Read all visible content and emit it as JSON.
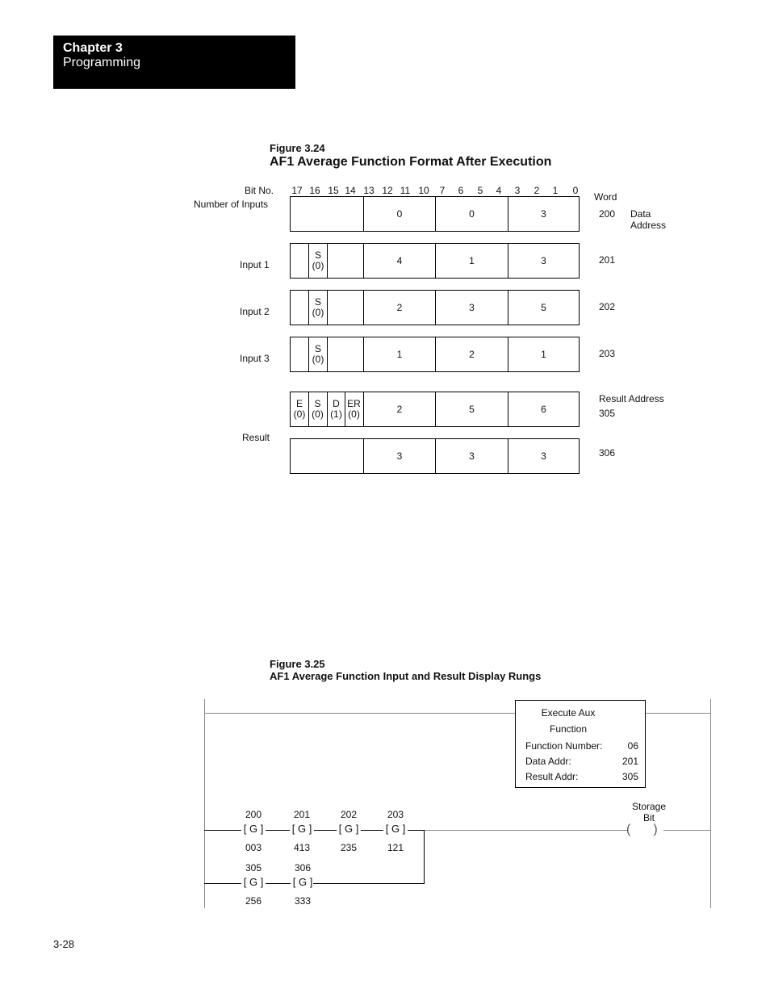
{
  "header": {
    "chapter": "Chapter 3",
    "section": "Programming"
  },
  "figure1": {
    "number": "Figure 3.24",
    "title": "AF1 Average Function Format After Execution",
    "bit_label": "Bit No.",
    "bits": [
      "17",
      "16",
      "15",
      "14",
      "13",
      "12",
      "11",
      "10",
      "7",
      "6",
      "5",
      "4",
      "3",
      "2",
      "1",
      "0"
    ],
    "word_header": "Word",
    "rows": [
      {
        "label": "Number of Inputs",
        "word": "200",
        "note": "Data Address",
        "flags": [],
        "digits": [
          "0",
          "0",
          "3"
        ]
      },
      {
        "label": "Input 1",
        "word": "201",
        "flags": [
          {
            "name": "S",
            "val": "(0)"
          }
        ],
        "digits": [
          "4",
          "1",
          "3"
        ]
      },
      {
        "label": "Input 2",
        "word": "202",
        "flags": [
          {
            "name": "S",
            "val": "(0)"
          }
        ],
        "digits": [
          "2",
          "3",
          "5"
        ]
      },
      {
        "label": "Input 3",
        "word": "203",
        "flags": [
          {
            "name": "S",
            "val": "(0)"
          }
        ],
        "digits": [
          "1",
          "2",
          "1"
        ]
      },
      {
        "label": "Result",
        "word": "305",
        "note": "Result Address",
        "flags": [
          {
            "name": "E",
            "val": "(0)"
          },
          {
            "name": "S",
            "val": "(0)"
          },
          {
            "name": "D",
            "val": "(1)"
          },
          {
            "name": "ER",
            "val": "(0)"
          }
        ],
        "digits": [
          "2",
          "5",
          "6"
        ]
      },
      {
        "label": "",
        "word": "306",
        "flags": [],
        "digits": [
          "3",
          "3",
          "3"
        ]
      }
    ]
  },
  "figure2": {
    "number": "Figure 3.25",
    "title": "AF1 Average Function Input and Result Display Rungs",
    "function_block": {
      "title_line1": "Execute Aux",
      "title_line2": "Function",
      "fields": [
        {
          "label": "Function Number:",
          "value": "06"
        },
        {
          "label": "Data Addr:",
          "value": "201"
        },
        {
          "label": "Result Addr:",
          "value": "305"
        }
      ]
    },
    "rung1_contacts": [
      {
        "addr": "200",
        "symbol": "G",
        "value": "003"
      },
      {
        "addr": "201",
        "symbol": "G",
        "value": "413"
      },
      {
        "addr": "202",
        "symbol": "G",
        "value": "235"
      },
      {
        "addr": "203",
        "symbol": "G",
        "value": "121"
      }
    ],
    "rung2_contacts": [
      {
        "addr": "305",
        "symbol": "G",
        "value": "256"
      },
      {
        "addr": "306",
        "symbol": "G",
        "value": "333"
      }
    ],
    "coil": {
      "label_line1": "Storage",
      "label_line2": "Bit"
    }
  },
  "footer": {
    "page_number": "3-28"
  }
}
